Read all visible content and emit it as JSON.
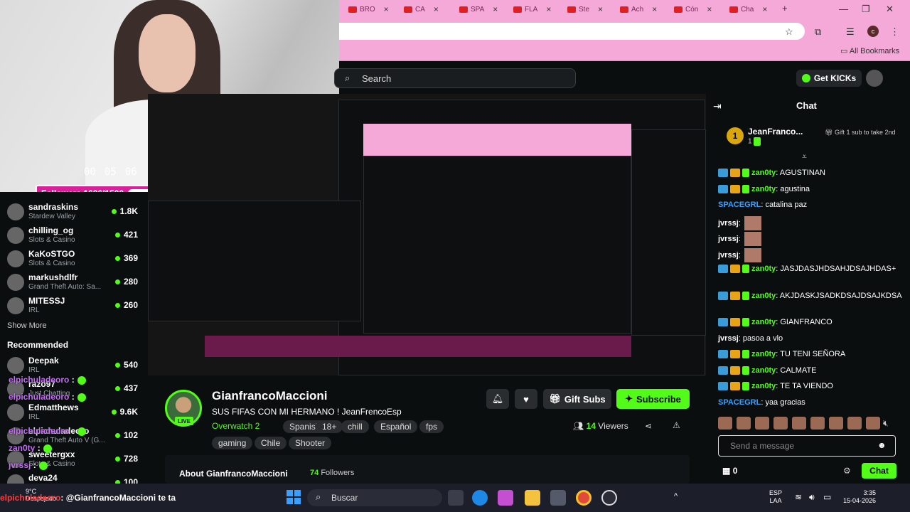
{
  "browser": {
    "tabs": [
      {
        "label": "BRO",
        "icon": "youtube-icon"
      },
      {
        "label": "CA",
        "icon": "youtube-icon"
      },
      {
        "label": "SPA",
        "icon": "folder-icon"
      },
      {
        "label": "FLA",
        "icon": "youtube-icon"
      },
      {
        "label": "Ste",
        "icon": "youtube-icon"
      },
      {
        "label": "Ach",
        "icon": "kick-icon"
      },
      {
        "label": "Cón",
        "icon": "youtube-icon"
      },
      {
        "label": "Cha",
        "icon": "chrome-icon"
      }
    ],
    "bookmarks_label": "All Bookmarks"
  },
  "webcam": {
    "timer": [
      "00",
      "05",
      "06"
    ],
    "followers_goal": "Followers 1606/1500",
    "followers_progress": 1.0
  },
  "header": {
    "search_placeholder": "Search",
    "get_kicks": "Get KICKs"
  },
  "sidebar": {
    "following": [
      {
        "name": "sandraskins",
        "category": "Stardew Valley",
        "viewers": "1.8K"
      },
      {
        "name": "chilling_og",
        "category": "Slots & Casino",
        "viewers": "421"
      },
      {
        "name": "KaKoSTGO",
        "category": "Slots & Casino",
        "viewers": "369"
      },
      {
        "name": "markushdlfr",
        "category": "Grand Theft Auto: Sa...",
        "viewers": "280"
      },
      {
        "name": "MITESSJ",
        "category": "IRL",
        "viewers": "260"
      }
    ],
    "show_more": "Show More",
    "recommended_label": "Recommended",
    "recommended": [
      {
        "name": "Deepak",
        "category": "IRL",
        "viewers": "540"
      },
      {
        "name": "razo97",
        "category": "Just Chatting",
        "viewers": "437"
      },
      {
        "name": "Edmatthews",
        "category": "IRL",
        "viewers": "9.6K"
      },
      {
        "name": "elpichuladeoro",
        "category": "Grand Theft Auto V (G...",
        "viewers": "102"
      },
      {
        "name": "sweetergxx",
        "category": "Slots & Casino",
        "viewers": "728"
      },
      {
        "name": "deva24",
        "category": "",
        "viewers": "100"
      }
    ]
  },
  "overlay_chat": [
    {
      "user": "elpichuladeoro",
      "sep": " :"
    },
    {
      "user": "elpichuladeoro",
      "sep": " :"
    },
    {
      "user": "elpichuladeoro",
      "sep": " :"
    },
    {
      "user": "zan0ty",
      "sep": " :"
    },
    {
      "user": "jvrssj",
      "sep": " :"
    }
  ],
  "stream": {
    "streamer": "GianfrancoMaccioni",
    "live": "LIVE",
    "title": "SUS FIFAS CON MI HERMANO ! JeanFrencoEsp",
    "category": "Overwatch 2",
    "tags": [
      "Spanish",
      "18+",
      "chill",
      "Español",
      "fps",
      "gaming",
      "Chile",
      "Shooter"
    ],
    "gift_subs": "Gift Subs",
    "subscribe": "Subscribe",
    "viewers_count": "14",
    "viewers_label": "Viewers",
    "about_title": "About GianfrancoMaccioni",
    "followers_count": "74",
    "followers_label": "Followers"
  },
  "chat": {
    "title": "Chat",
    "pinned_name": "JeanFranco...",
    "pinned_count": "1",
    "pinned_gift": "Gift 1 sub to take 2nd",
    "messages": [
      {
        "user": "zan0ty",
        "text": "AGUSTINAN",
        "badges": true,
        "color": "#53fc18"
      },
      {
        "user": "zan0ty",
        "text": "agustina",
        "badges": true,
        "color": "#53fc18"
      },
      {
        "user": "SPACEGRL",
        "text": "catalina paz",
        "badges": false,
        "color": "#3aa0ff"
      },
      {
        "user": "jvrssj",
        "text": "",
        "badges": false,
        "color": "#fff",
        "emote": true
      },
      {
        "user": "jvrssj",
        "text": "",
        "badges": false,
        "color": "#fff",
        "emote": true
      },
      {
        "user": "jvrssj",
        "text": "",
        "badges": false,
        "color": "#fff",
        "emote": true
      },
      {
        "user": "zan0ty",
        "text": "JASJDASJHDSAHJDSAJHDAS+",
        "badges": true,
        "color": "#53fc18"
      },
      {
        "user": "zan0ty",
        "text": "AKJDASKJSADKDSAJDSAJKDSA",
        "badges": true,
        "color": "#53fc18"
      },
      {
        "user": "zan0ty",
        "text": "GIANFRANCO",
        "badges": true,
        "color": "#53fc18"
      },
      {
        "user": "jvrssj",
        "text": "pasoa a vlo",
        "badges": false,
        "color": "#fff"
      },
      {
        "user": "zan0ty",
        "text": "TU TENI SEÑORA",
        "badges": true,
        "color": "#53fc18"
      },
      {
        "user": "zan0ty",
        "text": "CALMATE",
        "badges": true,
        "color": "#53fc18"
      },
      {
        "user": "zan0ty",
        "text": "TE TA VIENDO",
        "badges": true,
        "color": "#53fc18"
      },
      {
        "user": "SPACEGRL",
        "text": "yaa gracias",
        "badges": false,
        "color": "#3aa0ff"
      }
    ],
    "input_placeholder": "Send a message",
    "kicks": "0",
    "send": "Chat"
  },
  "taskbar": {
    "weather_temp": "9°C",
    "weather_desc": "Despejado",
    "search": "Buscar",
    "lang1": "ESP",
    "lang2": "LAA",
    "time": "3:35",
    "date": "15-04-2026",
    "ticker_user": "elpichuladeoro",
    "ticker_text": ": @GianfrancoMaccioni te ta"
  }
}
